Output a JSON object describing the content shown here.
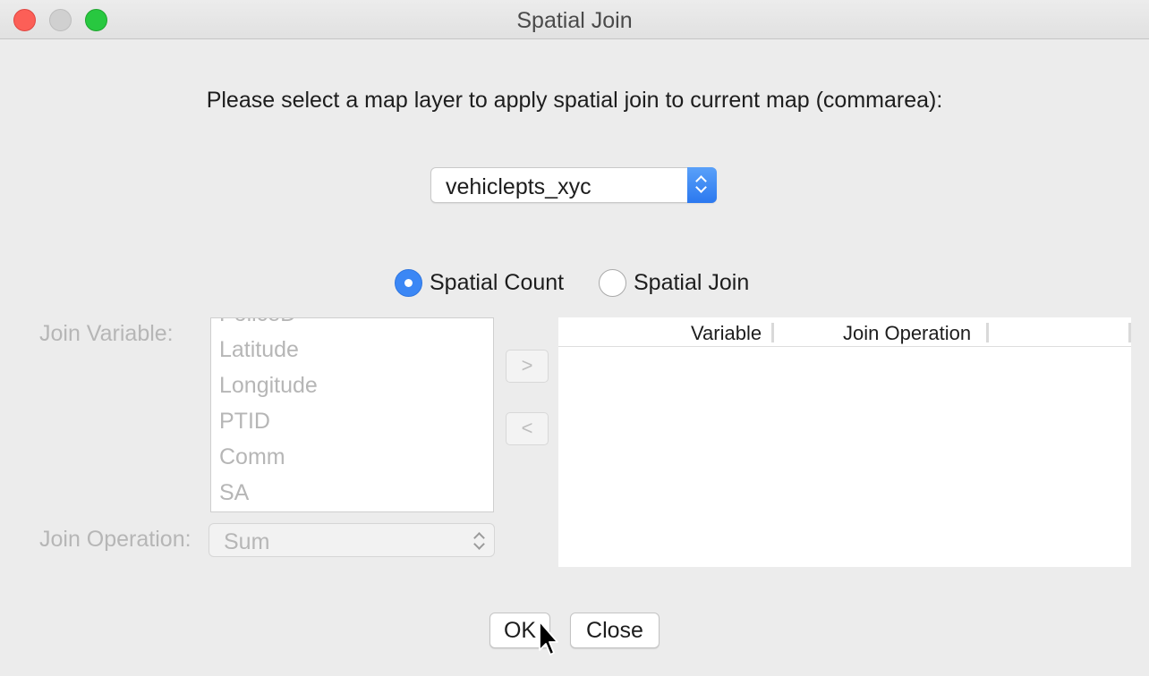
{
  "window": {
    "title": "Spatial Join"
  },
  "prompt": "Please select a map layer to apply spatial join to current map (commarea):",
  "layer_select": {
    "value": "vehiclepts_xyc"
  },
  "mode": {
    "options": [
      {
        "label": "Spatial Count",
        "selected": true
      },
      {
        "label": "Spatial Join",
        "selected": false
      }
    ]
  },
  "join_variable": {
    "label": "Join Variable:",
    "partial_top_item": "PoliceD",
    "items": [
      "Latitude",
      "Longitude",
      "PTID",
      "Comm",
      "SA"
    ]
  },
  "buttons": {
    "add": ">",
    "remove": "<",
    "ok": "OK",
    "close": "Close"
  },
  "join_operation": {
    "label": "Join Operation:",
    "value": "Sum"
  },
  "table": {
    "columns": [
      "Variable",
      "Join Operation"
    ],
    "rows": []
  },
  "colors": {
    "accent": "#3b87f5",
    "disabled_text": "#b6b6b6",
    "close": "#fc5f57",
    "zoom": "#28c840"
  }
}
